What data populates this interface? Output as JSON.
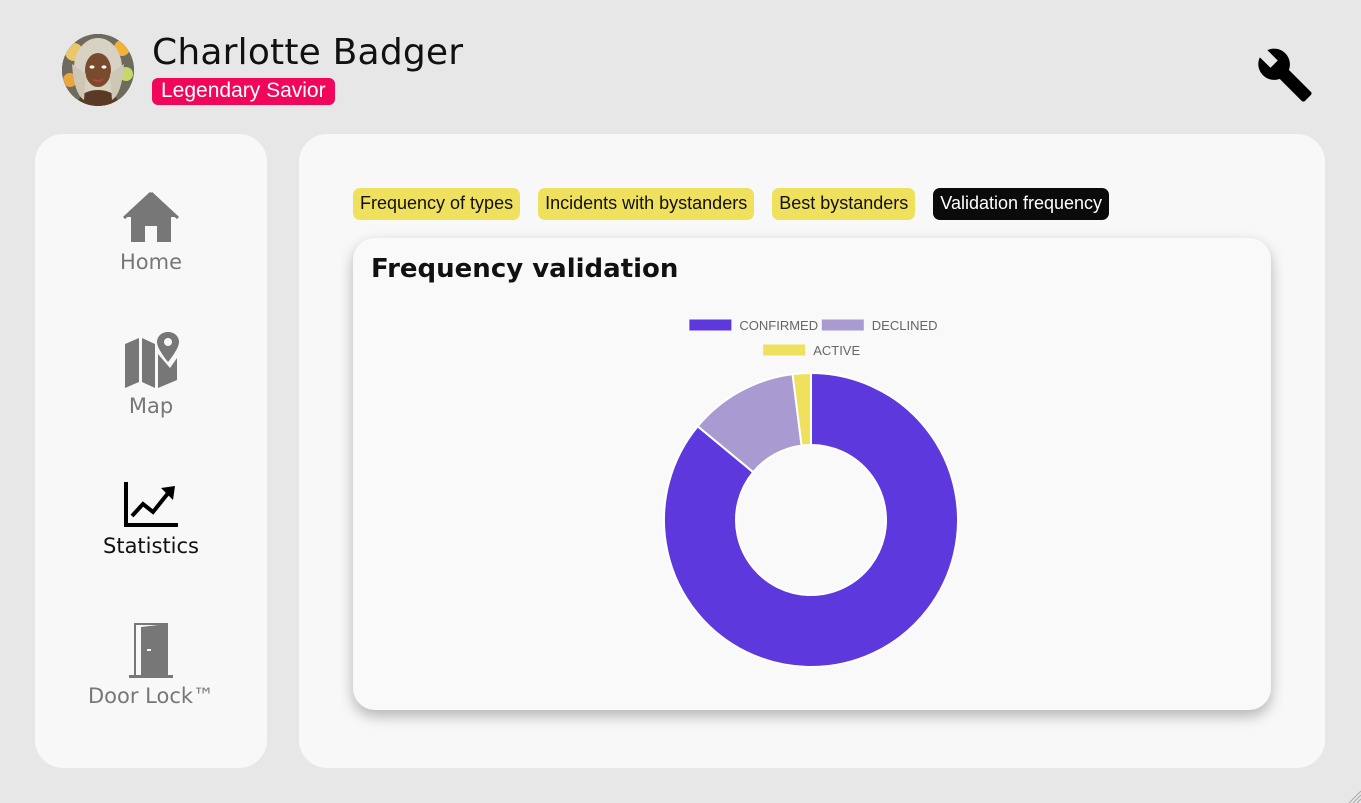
{
  "user": {
    "name": "Charlotte Badger",
    "rank": "Legendary Savior"
  },
  "settings_icon": "wrench-icon",
  "sidebar": {
    "items": [
      {
        "label": "Home",
        "icon": "home-icon",
        "active": false
      },
      {
        "label": "Map",
        "icon": "map-icon",
        "active": false
      },
      {
        "label": "Statistics",
        "icon": "chart-line-icon",
        "active": true
      },
      {
        "label": "Door Lock™",
        "icon": "door-icon",
        "active": false
      }
    ]
  },
  "tabs": [
    {
      "label": "Frequency of types",
      "active": false
    },
    {
      "label": "Incidents with bystanders",
      "active": false
    },
    {
      "label": "Best bystanders",
      "active": false
    },
    {
      "label": "Validation frequency",
      "active": true
    }
  ],
  "colors": {
    "rank_badge": "#f0075a",
    "tab_bg": "#efe05d",
    "tab_active_bg": "#0b0b0b",
    "confirmed": "#5c38dd",
    "declined": "#a99ad2",
    "active": "#efe05d"
  },
  "chart_data": {
    "type": "pie",
    "title": "Frequency validation",
    "legend_position": "top",
    "categories": [
      "CONFIRMED",
      "DECLINED",
      "ACTIVE"
    ],
    "values": [
      86,
      12,
      2
    ],
    "colors": [
      "#5c38dd",
      "#a99ad2",
      "#efe05d"
    ]
  }
}
